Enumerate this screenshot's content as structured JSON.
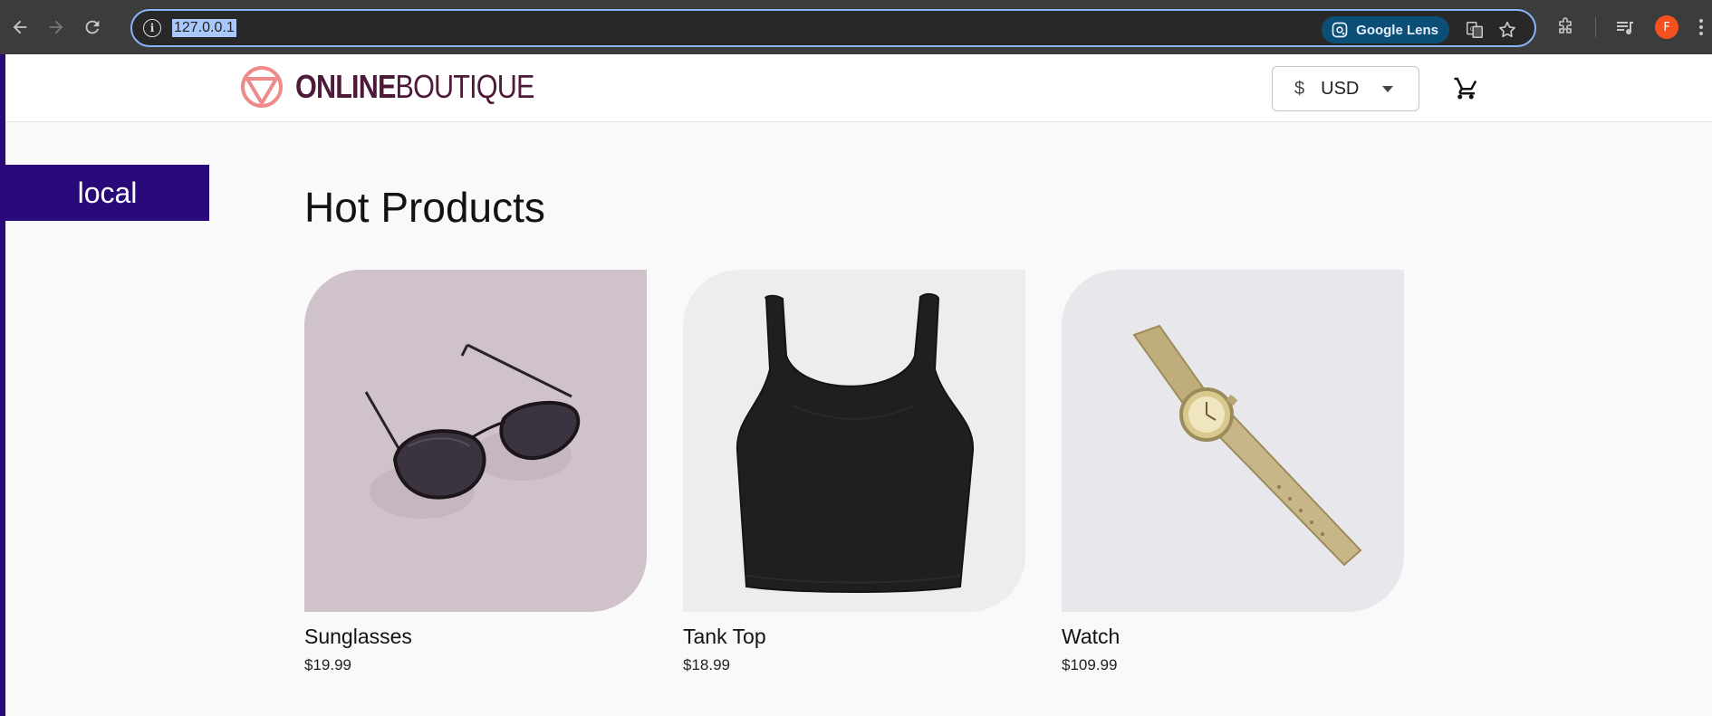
{
  "browser": {
    "url": "127.0.0.1",
    "lens_label": "Google Lens",
    "profile_initial": "F"
  },
  "header": {
    "logo_bold": "ONLINE",
    "logo_light": "BOUTIQUE",
    "currency_symbol": "$",
    "currency_code": "USD"
  },
  "env_badge": "local",
  "section_title": "Hot Products",
  "products": [
    {
      "name": "Sunglasses",
      "price": "$19.99",
      "icon": "sunglasses-image"
    },
    {
      "name": "Tank Top",
      "price": "$18.99",
      "icon": "tank-top-image"
    },
    {
      "name": "Watch",
      "price": "$109.99",
      "icon": "watch-image"
    }
  ],
  "colors": {
    "brand": "#4f1a3a",
    "logo_accent": "#ef8a8a",
    "badge": "#2a0a7a"
  }
}
